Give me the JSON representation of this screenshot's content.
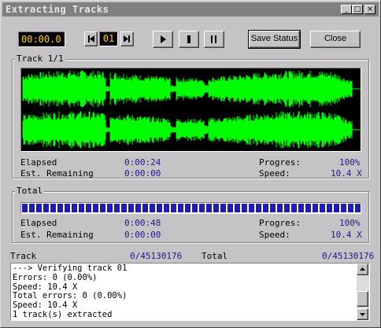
{
  "window": {
    "title": "Extracting Tracks",
    "caption_buttons": [
      "_",
      "□",
      "×"
    ]
  },
  "toolbar": {
    "time_display": "00:00.0",
    "track_number": "01",
    "prev_icon": "prev-track-icon",
    "next_icon": "next-track-icon",
    "play_icon": "play-icon",
    "stop_icon": "stop-icon",
    "pause_icon": "pause-icon",
    "save_status_label": "Save Status",
    "close_label": "Close"
  },
  "track_group": {
    "title": "Track 1/1",
    "elapsed_label": "Elapsed",
    "elapsed_value": "0:00:24",
    "remaining_label": "Est. Remaining",
    "remaining_value": "0:00:00",
    "progress_label": "Progres:",
    "progress_value": "100%",
    "speed_label": "Speed:",
    "speed_value": "10.4 X",
    "waveform_color": "#00ff00"
  },
  "total_group": {
    "title": "Total",
    "progress_fraction": 1.0,
    "bar_color": "#1e1eb4",
    "elapsed_label": "Elapsed",
    "elapsed_value": "0:00:48",
    "remaining_label": "Est. Remaining",
    "remaining_value": "0:00:00",
    "progress_label": "Progres:",
    "progress_value": "100%",
    "speed_label": "Speed:",
    "speed_value": "10.4 X"
  },
  "summary": {
    "track_label": "Track",
    "track_value": "0/45130176",
    "total_label": "Total",
    "total_value": "0/45130176"
  },
  "log": {
    "lines": [
      "---> Verifying track 01",
      "  Errors: 0 (0.00%)",
      "  Speed: 10.4 X",
      "Total errors: 0 (0.00%)",
      "Speed: 10.4 X",
      "1 track(s) extracted"
    ]
  }
}
